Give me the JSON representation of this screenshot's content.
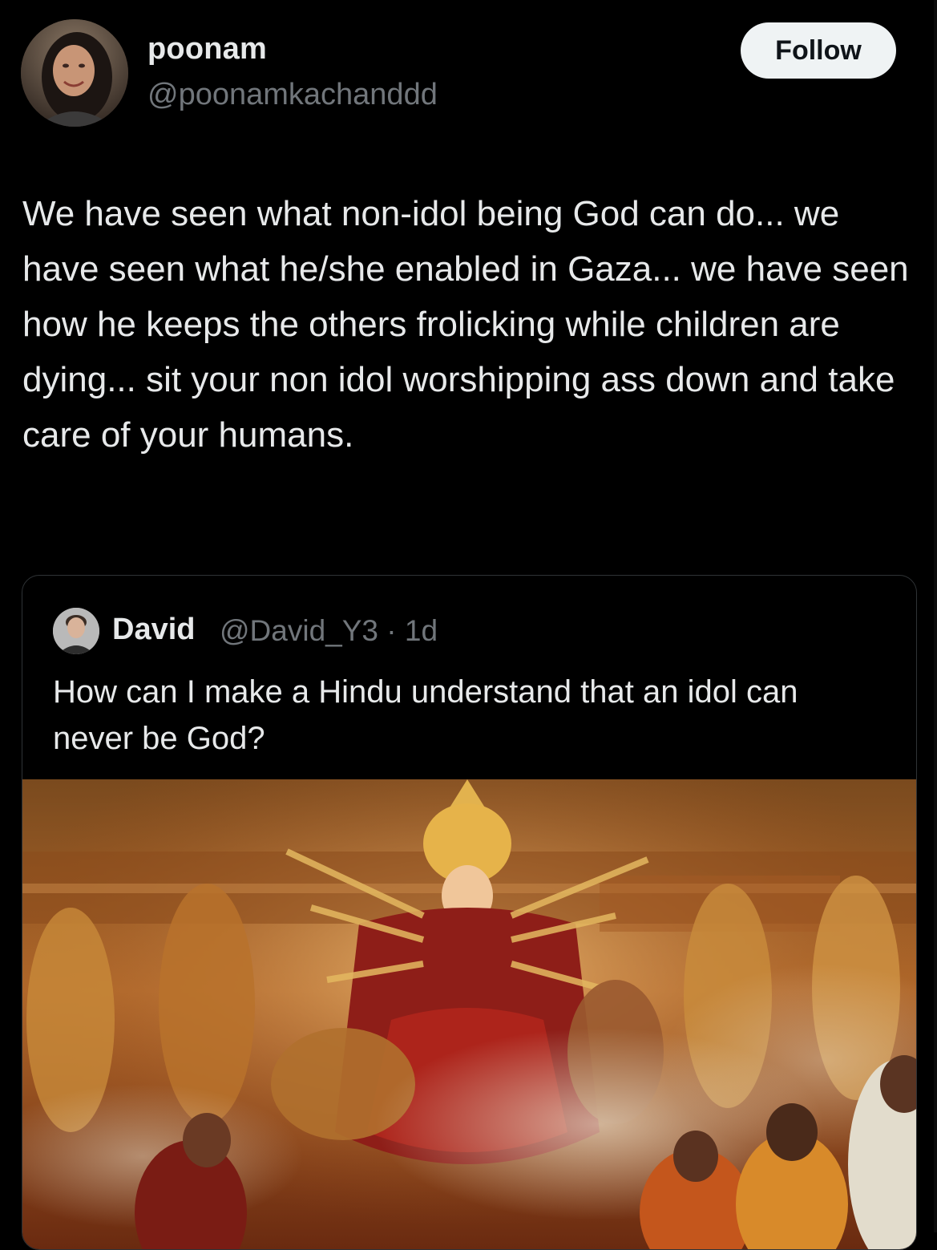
{
  "post": {
    "author": {
      "display_name": "poonam",
      "handle": "@poonamkachanddd",
      "avatar_icon": "user-avatar"
    },
    "follow_label": "Follow",
    "text": "We have seen what non-idol being God can do... we have seen what he/she enabled in Gaza... we have seen how he keeps the others frolicking while children are dying... sit your non idol worshipping ass down and take care of your humans."
  },
  "quote": {
    "author": {
      "display_name": "David",
      "handle_time": "@David_Y3 · 1d",
      "avatar_icon": "user-avatar"
    },
    "text": "How can I make a Hindu understand that an idol can never be God?",
    "media_icon": "photo-image"
  },
  "colors": {
    "background": "#000000",
    "text_primary": "#e7e9ea",
    "text_secondary": "#71767b",
    "border": "#2f3336",
    "follow_bg": "#eff3f4"
  }
}
